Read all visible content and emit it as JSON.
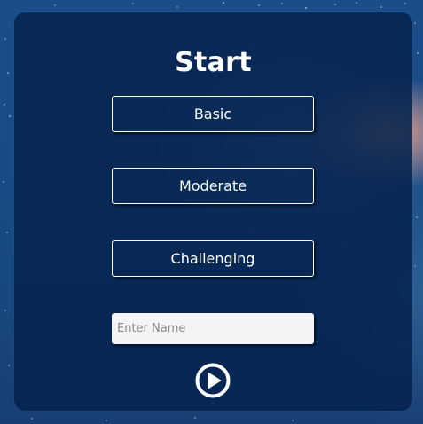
{
  "title": "Start",
  "difficulty": {
    "basic": "Basic",
    "moderate": "Moderate",
    "challenging": "Challenging"
  },
  "name_input": {
    "placeholder": "Enter Name",
    "value": ""
  },
  "play_button": {
    "icon": "play-circle-icon"
  },
  "colors": {
    "panel": "#06234e",
    "text": "#ffffff",
    "input_bg": "#f4f4f4"
  }
}
